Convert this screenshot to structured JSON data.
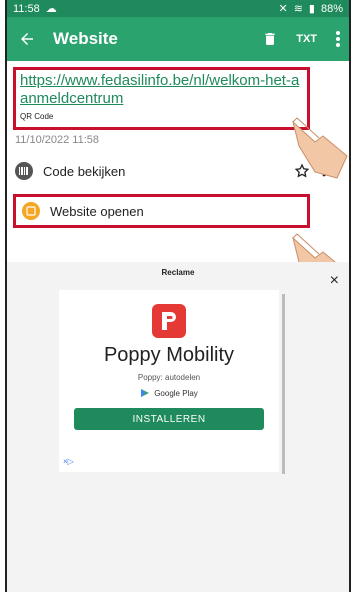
{
  "status": {
    "time": "11:58",
    "battery": "88%"
  },
  "appbar": {
    "title": "Website"
  },
  "icons": {
    "back": "back-arrow-icon",
    "delete": "trash-icon",
    "txt": "TXT",
    "more": "more-vert-icon"
  },
  "content": {
    "url": "https://www.fedasilinfo.be/nl/welkom-het-aanmeldcentrum",
    "code_type": "QR Code",
    "date": "11/10/2022 11:58",
    "row_view_label": "Code bekijken",
    "row_open_label": "Website openen"
  },
  "ad": {
    "label": "Reclame",
    "title": "Poppy Mobility",
    "subtitle": "Poppy: autodelen",
    "store": "Google Play",
    "button": "INSTALLEREN",
    "close": "×",
    "choices": "×▷"
  },
  "colors": {
    "primary": "#2aa36e",
    "dark": "#1f8a5b",
    "highlight": "#c8102e",
    "ad_logo": "#e53935"
  }
}
